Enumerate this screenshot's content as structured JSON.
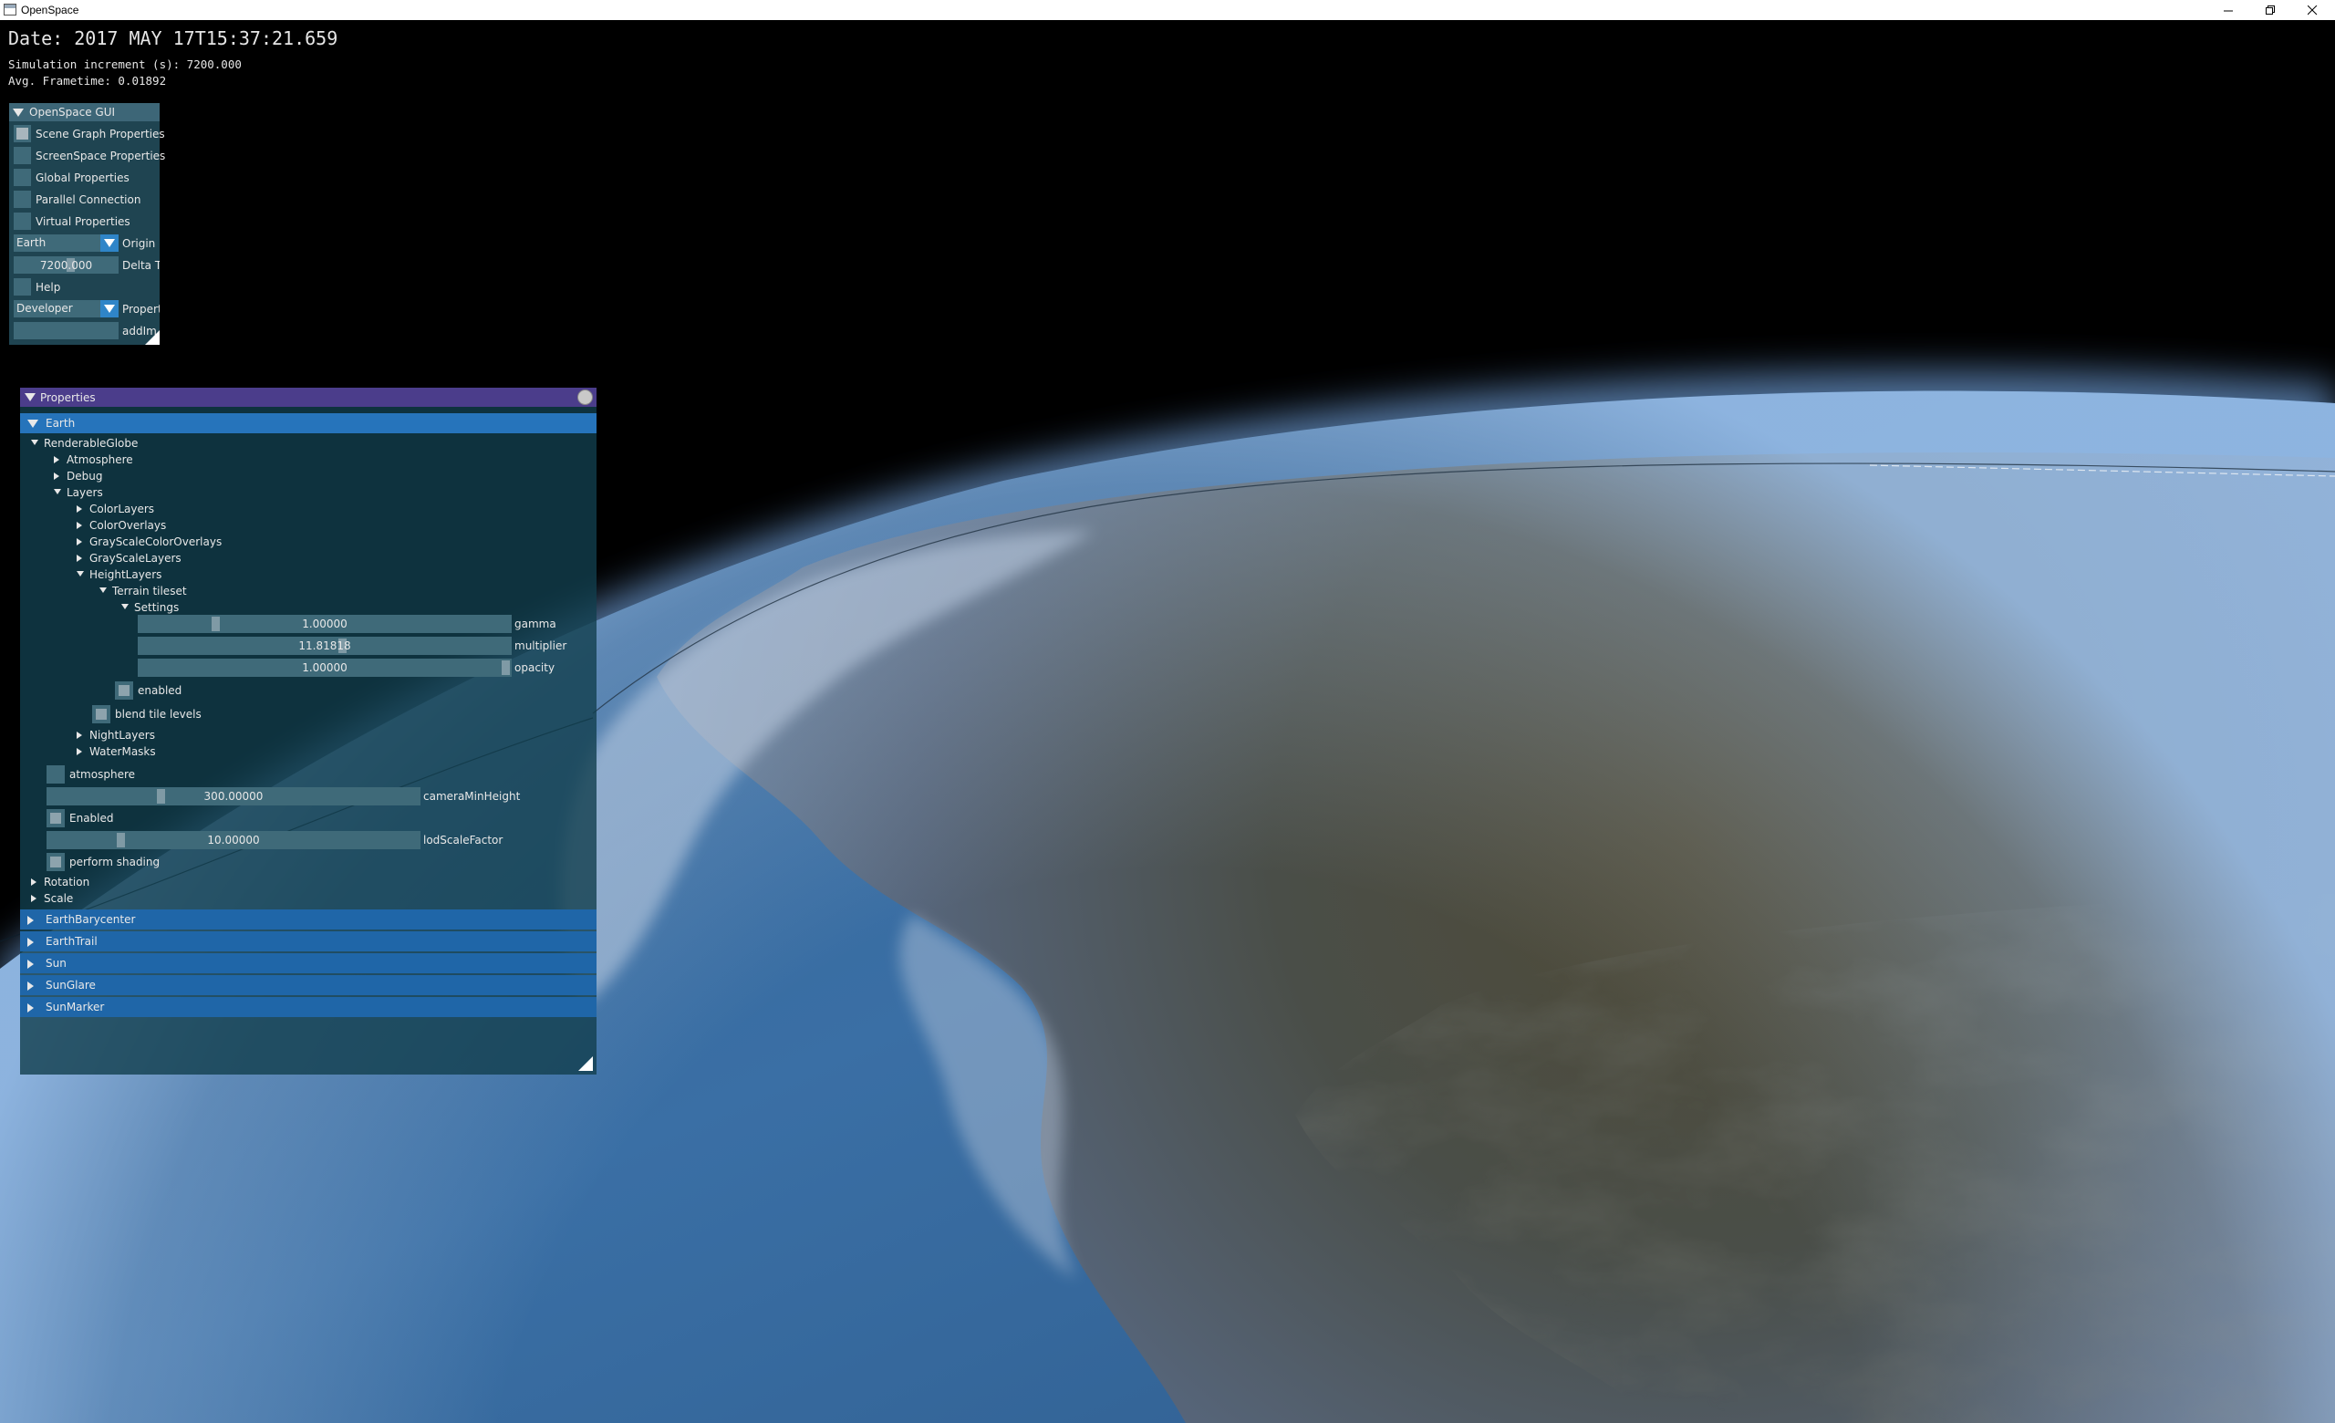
{
  "window": {
    "title": "OpenSpace"
  },
  "hud": {
    "date": "Date: 2017 MAY 17T15:37:21.659",
    "increment": "Simulation increment (s): 7200.000",
    "frametime": "Avg. Frametime: 0.01892"
  },
  "gui": {
    "title": "OpenSpace GUI",
    "items": [
      "Scene Graph Properties",
      "ScreenSpace Properties",
      "Global Properties",
      "Parallel Connection",
      "Virtual Properties"
    ],
    "origin": {
      "value": "Earth",
      "label": "Origin"
    },
    "delta_time": {
      "value": "7200.000",
      "label": "Delta Tim"
    },
    "help": "Help",
    "property": {
      "value": "Developer",
      "label": "Property"
    },
    "add_image": "addIm"
  },
  "props": {
    "title": "Properties",
    "nodes": [
      "Earth",
      "EarthBarycenter",
      "EarthTrail",
      "Sun",
      "SunGlare",
      "SunMarker"
    ],
    "tree": {
      "renderable_globe": "RenderableGlobe",
      "atmosphere": "Atmosphere",
      "debug": "Debug",
      "layers": "Layers",
      "color_layers": "ColorLayers",
      "color_overlays": "ColorOverlays",
      "grayscale_color_overlays": "GrayScaleColorOverlays",
      "grayscale_layers": "GrayScaleLayers",
      "height_layers": "HeightLayers",
      "terrain_tileset": "Terrain tileset",
      "settings": "Settings",
      "night_layers": "NightLayers",
      "water_masks": "WaterMasks",
      "rotation": "Rotation",
      "scale": "Scale"
    },
    "settings": {
      "gamma": {
        "value": "1.00000",
        "label": "gamma",
        "fill": 0.2
      },
      "multiplier": {
        "value": "11.81818",
        "label": "multiplier",
        "fill": 0.55
      },
      "opacity": {
        "value": "1.00000",
        "label": "opacity",
        "fill": 1.0
      }
    },
    "enabled_label": "enabled",
    "blend_tile_levels": "blend tile levels",
    "atmosphere_label": "atmosphere",
    "camera_min_height": {
      "value": "300.00000",
      "label": "cameraMinHeight",
      "fill": 0.3
    },
    "enabled_globe_label": "Enabled",
    "lod_scale_factor": {
      "value": "10.00000",
      "label": "lodScaleFactor",
      "fill": 0.19
    },
    "perform_shading_label": "perform shading"
  }
}
